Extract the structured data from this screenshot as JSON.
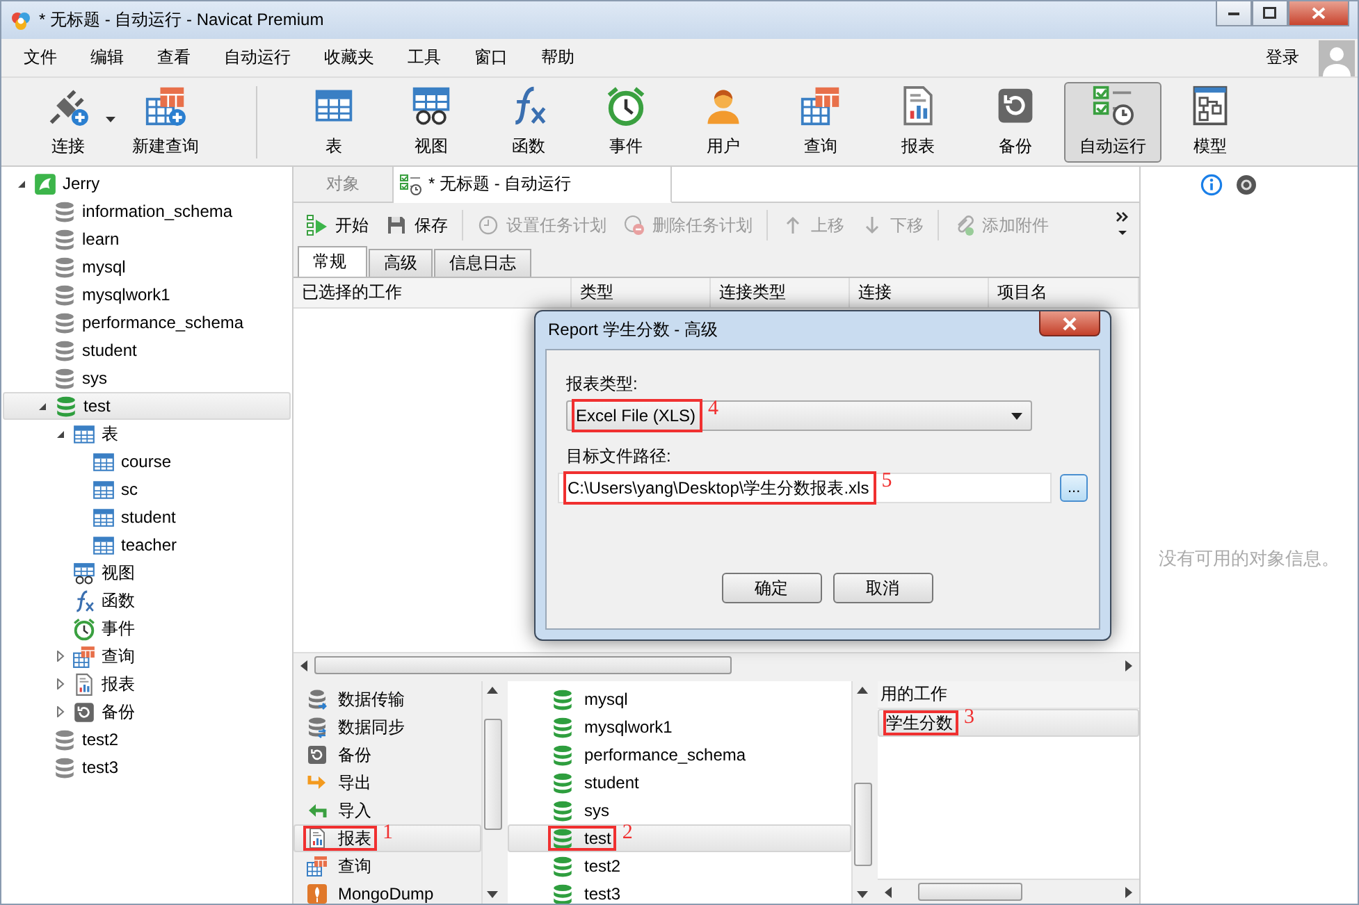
{
  "window": {
    "title": "* 无标题 - 自动运行 - Navicat Premium"
  },
  "menu": [
    "文件",
    "编辑",
    "查看",
    "自动运行",
    "收藏夹",
    "工具",
    "窗口",
    "帮助"
  ],
  "login": "登录",
  "toolbar": [
    {
      "label": "连接",
      "kind": "connect",
      "selected": false
    },
    {
      "label": "新建查询",
      "kind": "newquery",
      "selected": false
    },
    {
      "label": "表",
      "kind": "table",
      "selected": false
    },
    {
      "label": "视图",
      "kind": "view",
      "selected": false
    },
    {
      "label": "函数",
      "kind": "function",
      "selected": false
    },
    {
      "label": "事件",
      "kind": "event",
      "selected": false
    },
    {
      "label": "用户",
      "kind": "user",
      "selected": false
    },
    {
      "label": "查询",
      "kind": "query",
      "selected": false
    },
    {
      "label": "报表",
      "kind": "report",
      "selected": false
    },
    {
      "label": "备份",
      "kind": "backup",
      "selected": false
    },
    {
      "label": "自动运行",
      "kind": "automation",
      "selected": true
    },
    {
      "label": "模型",
      "kind": "model",
      "selected": false
    }
  ],
  "tree": [
    {
      "label": "Jerry",
      "kind": "connection",
      "expanded": true,
      "selected": false,
      "children": [
        {
          "label": "information_schema",
          "kind": "database",
          "open": false,
          "selected": false
        },
        {
          "label": "learn",
          "kind": "database",
          "open": false,
          "selected": false
        },
        {
          "label": "mysql",
          "kind": "database",
          "open": false,
          "selected": false
        },
        {
          "label": "mysqlwork1",
          "kind": "database",
          "open": false,
          "selected": false
        },
        {
          "label": "performance_schema",
          "kind": "database",
          "open": false,
          "selected": false
        },
        {
          "label": "student",
          "kind": "database",
          "open": false,
          "selected": false
        },
        {
          "label": "sys",
          "kind": "database",
          "open": false,
          "selected": false
        },
        {
          "label": "test",
          "kind": "database",
          "open": true,
          "expanded": true,
          "selected": true,
          "children": [
            {
              "label": "表",
              "kind": "table",
              "expanded": true,
              "selected": false,
              "children": [
                {
                  "label": "course",
                  "kind": "table",
                  "selected": false
                },
                {
                  "label": "sc",
                  "kind": "table",
                  "selected": false
                },
                {
                  "label": "student",
                  "kind": "table",
                  "selected": false
                },
                {
                  "label": "teacher",
                  "kind": "table",
                  "selected": false
                }
              ]
            },
            {
              "label": "视图",
              "kind": "view",
              "selected": false
            },
            {
              "label": "函数",
              "kind": "function",
              "selected": false
            },
            {
              "label": "事件",
              "kind": "event",
              "selected": false
            },
            {
              "label": "查询",
              "kind": "query",
              "expanded": false,
              "selected": false
            },
            {
              "label": "报表",
              "kind": "report",
              "expanded": false,
              "selected": false
            },
            {
              "label": "备份",
              "kind": "backup",
              "expanded": false,
              "selected": false
            }
          ]
        },
        {
          "label": "test2",
          "kind": "database",
          "open": false,
          "selected": false
        },
        {
          "label": "test3",
          "kind": "database",
          "open": false,
          "selected": false
        }
      ]
    }
  ],
  "tabs": [
    {
      "label": "对象",
      "kind": "objects",
      "selected": false
    },
    {
      "label": "* 无标题 - 自动运行",
      "kind": "automation",
      "selected": true
    }
  ],
  "action_groups": [
    [
      {
        "label": "开始",
        "kind": "start",
        "disabled": false
      },
      {
        "label": "保存",
        "kind": "save",
        "disabled": false
      }
    ],
    [
      {
        "label": "设置任务计划",
        "kind": "schedule",
        "disabled": true
      },
      {
        "label": "删除任务计划",
        "kind": "unschedule",
        "disabled": true
      }
    ],
    [
      {
        "label": "上移",
        "kind": "up",
        "disabled": true
      },
      {
        "label": "下移",
        "kind": "down",
        "disabled": true
      }
    ],
    [
      {
        "label": "添加附件",
        "kind": "attach",
        "disabled": true
      }
    ]
  ],
  "subtabs": [
    {
      "label": "常规",
      "selected": true
    },
    {
      "label": "高级",
      "selected": false
    },
    {
      "label": "信息日志",
      "selected": false
    }
  ],
  "columns": [
    "已选择的工作",
    "类型",
    "连接类型",
    "连接",
    "项目名"
  ],
  "bottom": {
    "categories": [
      {
        "label": "数据传输",
        "kind": "transfer",
        "selected": false,
        "marked": false
      },
      {
        "label": "数据同步",
        "kind": "sync",
        "selected": false,
        "marked": false
      },
      {
        "label": "备份",
        "kind": "backup",
        "selected": false,
        "marked": false
      },
      {
        "label": "导出",
        "kind": "export",
        "selected": false,
        "marked": false
      },
      {
        "label": "导入",
        "kind": "import",
        "selected": false,
        "marked": false
      },
      {
        "label": "报表",
        "kind": "report",
        "selected": true,
        "marked": true,
        "annotation": "1"
      },
      {
        "label": "查询",
        "kind": "query",
        "selected": false,
        "marked": false
      },
      {
        "label": "MongoDump",
        "kind": "mongodump",
        "selected": false,
        "marked": false
      }
    ],
    "connections": [
      {
        "label": "mysql",
        "open": true,
        "selected": false,
        "marked": false
      },
      {
        "label": "mysqlwork1",
        "open": true,
        "selected": false,
        "marked": false
      },
      {
        "label": "performance_schema",
        "open": true,
        "selected": false,
        "marked": false
      },
      {
        "label": "student",
        "open": true,
        "selected": false,
        "marked": false
      },
      {
        "label": "sys",
        "open": true,
        "selected": false,
        "marked": false
      },
      {
        "label": "test",
        "open": true,
        "selected": true,
        "marked": true,
        "annotation": "2"
      },
      {
        "label": "test2",
        "open": true,
        "selected": false,
        "marked": false
      },
      {
        "label": "test3",
        "open": true,
        "selected": false,
        "marked": false
      }
    ],
    "jobs": {
      "header": "用的工作",
      "items": [
        {
          "label": "学生分数",
          "selected": true,
          "marked": true,
          "annotation": "3"
        }
      ]
    }
  },
  "info_panel": {
    "message": "没有可用的对象信息。"
  },
  "dialog": {
    "title": "Report 学生分数 - 高级",
    "report_type": {
      "label": "报表类型:",
      "value": "Excel File (XLS)",
      "marked": true,
      "annotation": "4"
    },
    "target_path": {
      "label": "目标文件路径:",
      "value": "C:\\Users\\yang\\Desktop\\学生分数报表.xls",
      "marked": true,
      "annotation": "5"
    },
    "browse": "...",
    "buttons": [
      "确定",
      "取消"
    ]
  }
}
